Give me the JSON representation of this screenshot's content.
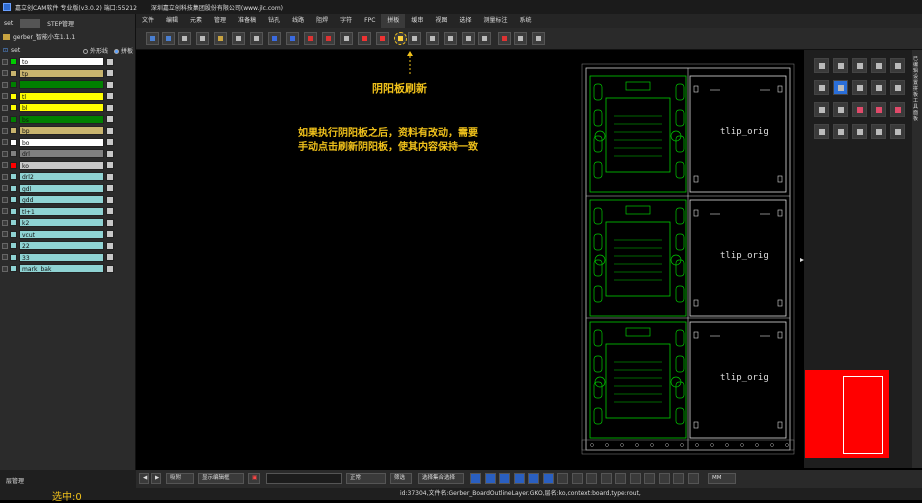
{
  "titlebar": {
    "app_title": "嘉立创CAM软件 专业版(v3.0.2) 端口:55212",
    "company": "深圳嘉立创科技集团股份有限公司(www.jlc.com)"
  },
  "menu": [
    "文件",
    "编辑",
    "元素",
    "管理",
    "准备稿",
    "钻孔",
    "线路",
    "阻焊",
    "字符",
    "FPC",
    "拼板",
    "缓串",
    "视图",
    "选择",
    "测量标注",
    "系统"
  ],
  "menu_active": "拼板",
  "left": {
    "tab_set": "set",
    "tab_step": "STEP管理",
    "job_name": "gerber_智能小车1.1.1",
    "set_label": "set",
    "opt_outline": "外形线",
    "opt_panel": "拼板",
    "selected_count": "选中:0",
    "layer_mgr": "层管理"
  },
  "layers": [
    {
      "name": "to",
      "swatch": "#00cc00",
      "bg": "#ffffff",
      "box": "#c8c8c8",
      "eye": "⊙"
    },
    {
      "name": "tp",
      "swatch": "#c8b46e",
      "bg": "#c8b46e",
      "box": "#c8c8c8",
      "eye": "⊙"
    },
    {
      "name": "",
      "swatch": "#008000",
      "bg": "#008000",
      "box": "#c8c8c8",
      "eye": ""
    },
    {
      "name": "tl",
      "swatch": "#ffff00",
      "bg": "#ffff00",
      "box": "#c8c8c8",
      "eye": ""
    },
    {
      "name": "bl",
      "swatch": "#ffff00",
      "bg": "#ffff00",
      "box": "#c8c8c8",
      "eye": ""
    },
    {
      "name": "bs",
      "swatch": "#008000",
      "bg": "#008000",
      "box": "#c8c8c8",
      "eye": ""
    },
    {
      "name": "bp",
      "swatch": "#c8b46e",
      "bg": "#c8b46e",
      "box": "#c8c8c8",
      "eye": "⊙"
    },
    {
      "name": "bo",
      "swatch": "#ffffff",
      "bg": "#ffffff",
      "box": "#c8c8c8",
      "eye": "⊙"
    },
    {
      "name": "drl",
      "swatch": "#808080",
      "bg": "#808080",
      "box": "#c8c8c8",
      "eye": ""
    },
    {
      "name": "ko",
      "swatch": "#ff0000",
      "bg": "#c8c8c8",
      "box": "#c8c8c8",
      "eye": "⊞"
    },
    {
      "name": "drl2",
      "swatch": "#8fd3d3",
      "bg": "#8fd3d3",
      "box": "#c8c8c8",
      "eye": "⊙"
    },
    {
      "name": "gdl",
      "swatch": "#8fd3d3",
      "bg": "#8fd3d3",
      "box": "#c8c8c8",
      "eye": "⊙"
    },
    {
      "name": "gdd",
      "swatch": "#8fd3d3",
      "bg": "#8fd3d3",
      "box": "#c8c8c8",
      "eye": "⊙"
    },
    {
      "name": "tl+1",
      "swatch": "#8fd3d3",
      "bg": "#8fd3d3",
      "box": "#c8c8c8",
      "eye": "⊙"
    },
    {
      "name": "k2",
      "swatch": "#8fd3d3",
      "bg": "#8fd3d3",
      "box": "#c8c8c8",
      "eye": "○"
    },
    {
      "name": "vcut",
      "swatch": "#8fd3d3",
      "bg": "#8fd3d3",
      "box": "#c8c8c8",
      "eye": ""
    },
    {
      "name": "22",
      "swatch": "#8fd3d3",
      "bg": "#8fd3d3",
      "box": "#c8c8c8",
      "eye": "⊙"
    },
    {
      "name": "33",
      "swatch": "#8fd3d3",
      "bg": "#8fd3d3",
      "box": "#c8c8c8",
      "eye": "⊙"
    },
    {
      "name": "mark_bak",
      "swatch": "#8fd3d3",
      "bg": "#8fd3d3",
      "box": "#c8c8c8",
      "eye": ""
    }
  ],
  "annotation": {
    "label": "阴阳板刷新",
    "line1": "如果执行阴阳板之后，资料有改动，需要",
    "line2": "手动点击刷新阴阳板，使其内容保持一致"
  },
  "board_text": "tlip_orig",
  "bottom": {
    "snap": "吸附",
    "btn_show": "显示编辑框",
    "mode": "正常",
    "filter": "筛选",
    "select_all": "选择集合选择",
    "units": "MM"
  },
  "status": "id:37304,文件名:Gerber_BoardOutlineLayer.GKO,层名:ko,context:board,type:rout,",
  "right_strip": "已编辑设置拼板工具面板"
}
